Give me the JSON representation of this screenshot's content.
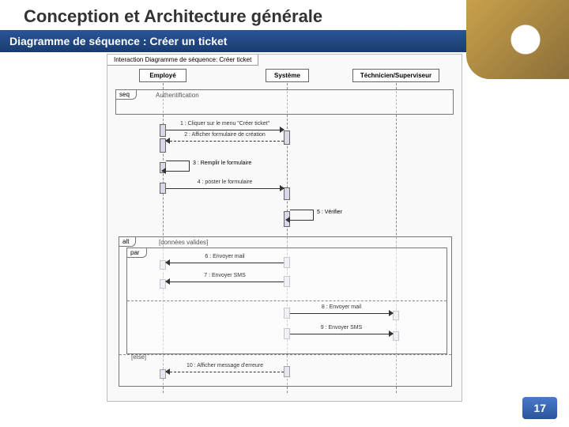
{
  "title": "Conception et Architecture générale",
  "subtitle": "Diagramme de séquence : Créer un ticket",
  "page_number": "17",
  "diagram": {
    "title": "Interaction Diagramme de séquence: Créer ticket",
    "lifelines": [
      "Employé",
      "Système",
      "Téchnicien/Superviseur"
    ],
    "seq_label": "seq",
    "seq_cond": "Authentification",
    "alt_label": "alt",
    "alt_cond": "[données valides]",
    "else_label": "[else]",
    "par_label": "par",
    "messages": {
      "m1": "1 : Cliquer sur le menu \"Créer ticket\"",
      "m2": "2 : Afficher formulaire de création",
      "m3": "3 : Remplir le formulaire",
      "m4": "4 : poster le formulaire",
      "m5": "5 : Vérifier",
      "m6": "6 : Envoyer mail",
      "m7": "7 : Envoyer SMS",
      "m8": "8 : Envoyer mail",
      "m9": "9 : Envoyer SMS",
      "m10": "10 : Afficher message d'erreure"
    }
  }
}
